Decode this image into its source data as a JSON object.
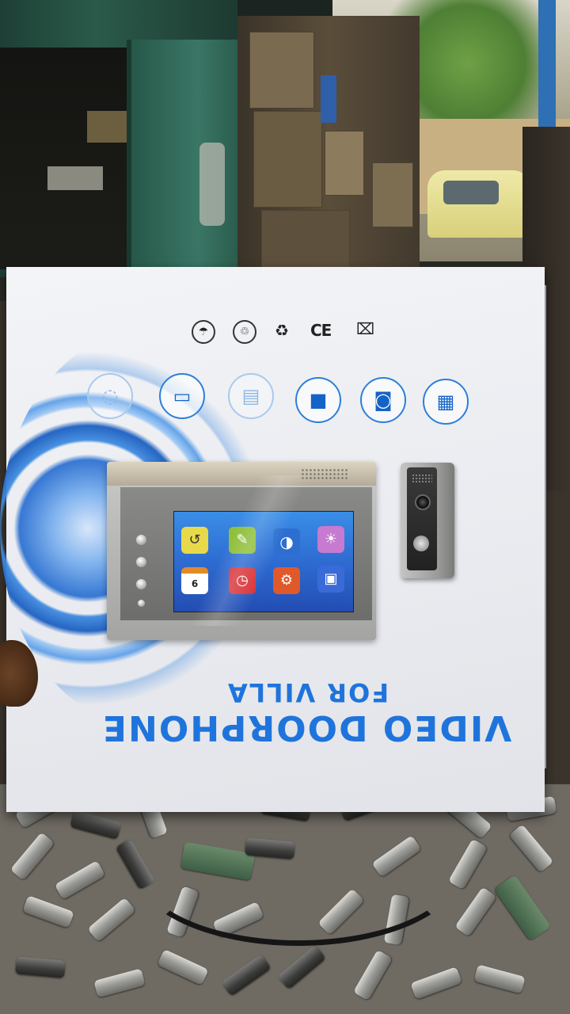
{
  "box": {
    "title_line1": "VIDEO DOORPHONE",
    "title_line2": "FOR VILLA",
    "certification_icons": [
      "waterproof-icon",
      "recycle-bin-icon",
      "recycle-icon",
      "ce-mark-icon",
      "no-trash-icon"
    ],
    "ce_mark": "CE",
    "feature_icons": [
      "snapshot-icon",
      "monitor-icon",
      "sd-card-icon",
      "camera-icon",
      "intercom-icon",
      "storage-icon"
    ]
  },
  "monitor": {
    "screen_apps": [
      "return-app-icon",
      "paint-palette-app-icon",
      "brightness-app-icon",
      "settings-sun-app-icon",
      "calendar-app-icon",
      "clock-app-icon",
      "gear-app-icon",
      "photo-app-icon"
    ],
    "calendar_day": "6"
  },
  "colors": {
    "brand_blue": "#1f74dc",
    "box_white": "#eceef2"
  }
}
